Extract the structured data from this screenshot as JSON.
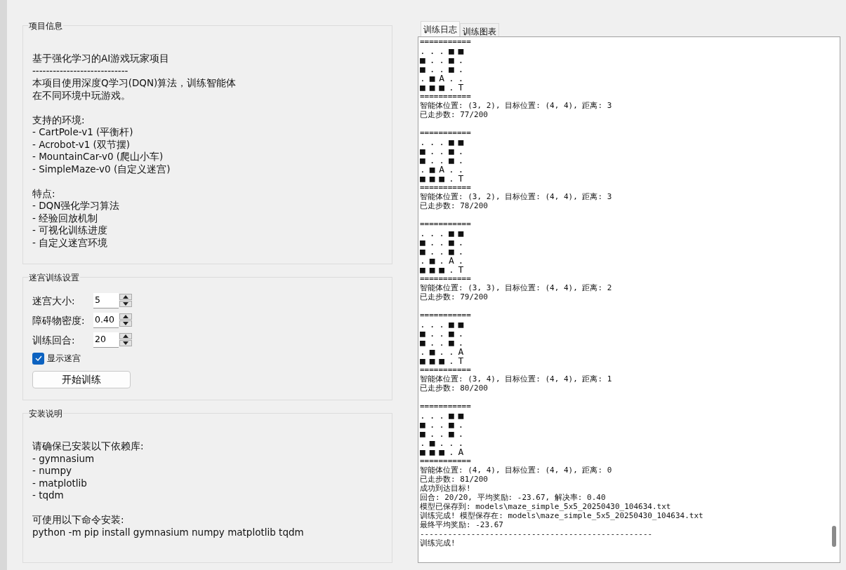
{
  "project_info": {
    "legend": "项目信息",
    "paragraphs": [
      [
        "基于强化学习的AI游戏玩家项目",
        "----------------------------",
        "本项目使用深度Q学习(DQN)算法，训练智能体",
        "在不同环境中玩游戏。"
      ],
      [
        "支持的环境:",
        "- CartPole-v1 (平衡杆)",
        "- Acrobot-v1 (双节摆)",
        "- MountainCar-v0 (爬山小车)",
        "- SimpleMaze-v0 (自定义迷宫)"
      ],
      [
        "特点:",
        "- DQN强化学习算法",
        "- 经验回放机制",
        "- 可视化训练进度",
        "- 自定义迷宫环境"
      ]
    ]
  },
  "settings": {
    "legend": "迷宫训练设置",
    "fields": [
      {
        "label": "迷宫大小:",
        "value": "5"
      },
      {
        "label": "障碍物密度:",
        "value": "0.40"
      },
      {
        "label": "训练回合:",
        "value": "20"
      }
    ],
    "checkbox": {
      "label": "显示迷宫",
      "checked": true
    },
    "button": "开始训练"
  },
  "install": {
    "legend": "安装说明",
    "paragraphs": [
      [
        "请确保已安装以下依赖库:",
        "- gymnasium",
        "- numpy",
        "- matplotlib",
        "- tqdm"
      ],
      [
        "可使用以下命令安装:",
        "python -m pip install gymnasium numpy matplotlib tqdm"
      ]
    ]
  },
  "tabs": [
    {
      "label": "训练日志",
      "selected": true
    },
    {
      "label": "训练图表",
      "selected": false
    }
  ],
  "log_blocks": [
    {
      "lines": [
        {
          "kind": "text",
          "text": "==========="
        },
        {
          "kind": "maze",
          "text": ". . . ■ ■"
        },
        {
          "kind": "maze",
          "text": "■ . . ■ ."
        },
        {
          "kind": "maze",
          "text": "■ . . ■ ."
        },
        {
          "kind": "maze",
          "text": ". ■ A . ."
        },
        {
          "kind": "maze",
          "text": "■ ■ ■ . T"
        },
        {
          "kind": "text",
          "text": "==========="
        },
        {
          "kind": "text",
          "text": "智能体位置: (3, 2), 目标位置: (4, 4), 距离: 3"
        },
        {
          "kind": "text",
          "text": "已走步数: 77/200"
        }
      ]
    },
    {
      "lines": [
        {
          "kind": "text",
          "text": "==========="
        },
        {
          "kind": "maze",
          "text": ". . . ■ ■"
        },
        {
          "kind": "maze",
          "text": "■ . . ■ ."
        },
        {
          "kind": "maze",
          "text": "■ . . ■ ."
        },
        {
          "kind": "maze",
          "text": ". ■ A . ."
        },
        {
          "kind": "maze",
          "text": "■ ■ ■ . T"
        },
        {
          "kind": "text",
          "text": "==========="
        },
        {
          "kind": "text",
          "text": "智能体位置: (3, 2), 目标位置: (4, 4), 距离: 3"
        },
        {
          "kind": "text",
          "text": "已走步数: 78/200"
        }
      ]
    },
    {
      "lines": [
        {
          "kind": "text",
          "text": "==========="
        },
        {
          "kind": "maze",
          "text": ". . . ■ ■"
        },
        {
          "kind": "maze",
          "text": "■ . . ■ ."
        },
        {
          "kind": "maze",
          "text": "■ . . ■ ."
        },
        {
          "kind": "maze",
          "text": ". ■ . A ."
        },
        {
          "kind": "maze",
          "text": "■ ■ ■ . T"
        },
        {
          "kind": "text",
          "text": "==========="
        },
        {
          "kind": "text",
          "text": "智能体位置: (3, 3), 目标位置: (4, 4), 距离: 2"
        },
        {
          "kind": "text",
          "text": "已走步数: 79/200"
        }
      ]
    },
    {
      "lines": [
        {
          "kind": "text",
          "text": "==========="
        },
        {
          "kind": "maze",
          "text": ". . . ■ ■"
        },
        {
          "kind": "maze",
          "text": "■ . . ■ ."
        },
        {
          "kind": "maze",
          "text": "■ . . ■ ."
        },
        {
          "kind": "maze",
          "text": ". ■ . . A"
        },
        {
          "kind": "maze",
          "text": "■ ■ ■ . T"
        },
        {
          "kind": "text",
          "text": "==========="
        },
        {
          "kind": "text",
          "text": "智能体位置: (3, 4), 目标位置: (4, 4), 距离: 1"
        },
        {
          "kind": "text",
          "text": "已走步数: 80/200"
        }
      ]
    },
    {
      "lines": [
        {
          "kind": "text",
          "text": "==========="
        },
        {
          "kind": "maze",
          "text": ". . . ■ ■"
        },
        {
          "kind": "maze",
          "text": "■ . . ■ ."
        },
        {
          "kind": "maze",
          "text": "■ . . ■ ."
        },
        {
          "kind": "maze",
          "text": ". ■ . . ."
        },
        {
          "kind": "maze",
          "text": "■ ■ ■ . A"
        },
        {
          "kind": "text",
          "text": "==========="
        },
        {
          "kind": "text",
          "text": "智能体位置: (4, 4), 目标位置: (4, 4), 距离: 0"
        },
        {
          "kind": "text",
          "text": "已走步数: 81/200"
        },
        {
          "kind": "text",
          "text": "成功到达目标!"
        },
        {
          "kind": "text",
          "text": "回合: 20/20, 平均奖励: -23.67, 解决率: 0.40"
        },
        {
          "kind": "text",
          "text": "模型已保存到: models\\maze_simple_5x5_20250430_104634.txt"
        },
        {
          "kind": "text",
          "text": "训练完成! 模型保存在: models\\maze_simple_5x5_20250430_104634.txt"
        },
        {
          "kind": "text",
          "text": "最终平均奖励: -23.67"
        },
        {
          "kind": "text",
          "text": "--------------------------------------------------"
        },
        {
          "kind": "text",
          "text": "训练完成!"
        }
      ]
    }
  ]
}
